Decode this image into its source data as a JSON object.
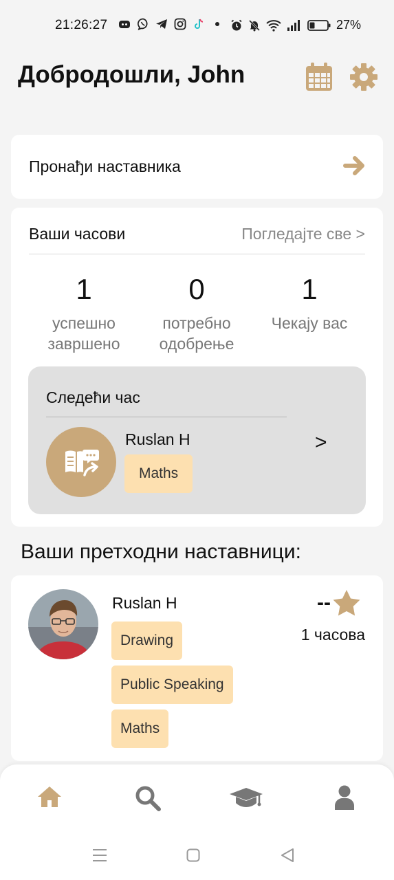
{
  "status_bar": {
    "time": "21:26:27",
    "battery": "27%"
  },
  "header": {
    "welcome": "Добродошли, John",
    "calendar_icon": "calendar-icon",
    "settings_icon": "gear-icon"
  },
  "find_teacher": {
    "label": "Пронађи наставника"
  },
  "classes": {
    "title": "Ваши часови",
    "see_all": "Погледајте све >",
    "stats": [
      {
        "value": "1",
        "label": "успешно завршено"
      },
      {
        "value": "0",
        "label": "потребно одобрење"
      },
      {
        "value": "1",
        "label": "Чекају вас"
      }
    ],
    "next_class": {
      "title": "Следећи час",
      "teacher": "Ruslan H",
      "subject": "Maths",
      "chevron": ">"
    }
  },
  "previous_teachers": {
    "heading": "Ваши претходни наставници:",
    "items": [
      {
        "name": "Ruslan H",
        "rating": "--",
        "hours": "1 часова",
        "subjects": [
          "Drawing",
          "Public Speaking",
          "Maths"
        ]
      }
    ]
  },
  "bottom_nav": {
    "items": [
      "home-icon",
      "search-icon",
      "graduation-cap-icon",
      "user-icon"
    ]
  },
  "colors": {
    "accent": "#c9a87a",
    "tag_bg": "#fde0b0",
    "card_bg": "#ffffff",
    "page_bg": "#f4f4f4",
    "next_box_bg": "#e0e0e0",
    "nav_inactive": "#777777"
  }
}
